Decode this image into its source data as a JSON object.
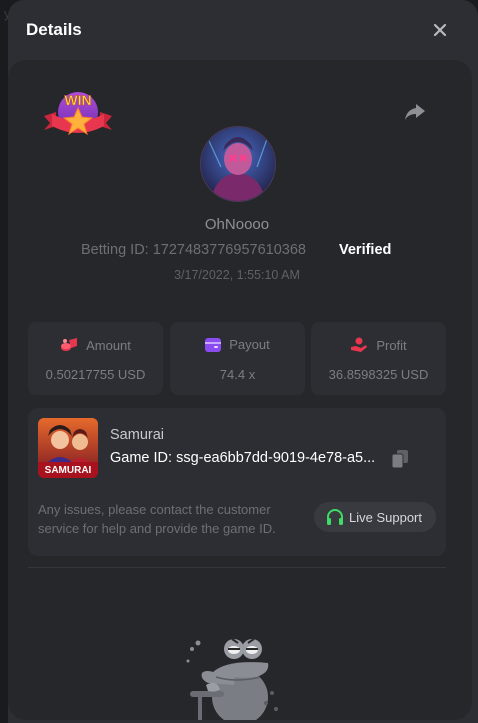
{
  "backdrop": {
    "fragment": "y"
  },
  "modal": {
    "title": "Details"
  },
  "player": {
    "username": "OhNoooo",
    "betting_id_label": "Betting ID:",
    "betting_id": "1727483776957610368",
    "verified_label": "Verified",
    "timestamp": "3/17/2022, 1:55:10 AM"
  },
  "win_badge": {
    "text": "WIN"
  },
  "stats": {
    "amount": {
      "label": "Amount",
      "value": "0.50217755 USD"
    },
    "payout": {
      "label": "Payout",
      "value": "74.4 x"
    },
    "profit": {
      "label": "Profit",
      "value": "36.8598325 USD"
    }
  },
  "game": {
    "name": "Samurai",
    "thumb_text": "SAMURAI",
    "id_label": "Game ID:",
    "id_value": "ssg-ea6bb7dd-9019-4e78-a5...",
    "help_text": "Any issues, please contact the customer service for help and provide the game ID.",
    "live_support_label": "Live Support"
  },
  "icons": {
    "close": "close-icon",
    "share": "share-icon",
    "amount": "coins-icon",
    "payout": "wallet-icon",
    "profit": "hand-money-icon",
    "copy": "copy-icon",
    "support": "headset-icon"
  },
  "colors": {
    "modal_bg": "#2c2e33",
    "content_bg": "#25272b",
    "accent_red": "#e8364f",
    "accent_purple": "#8a4cf0",
    "support_green": "#3ddc64"
  }
}
